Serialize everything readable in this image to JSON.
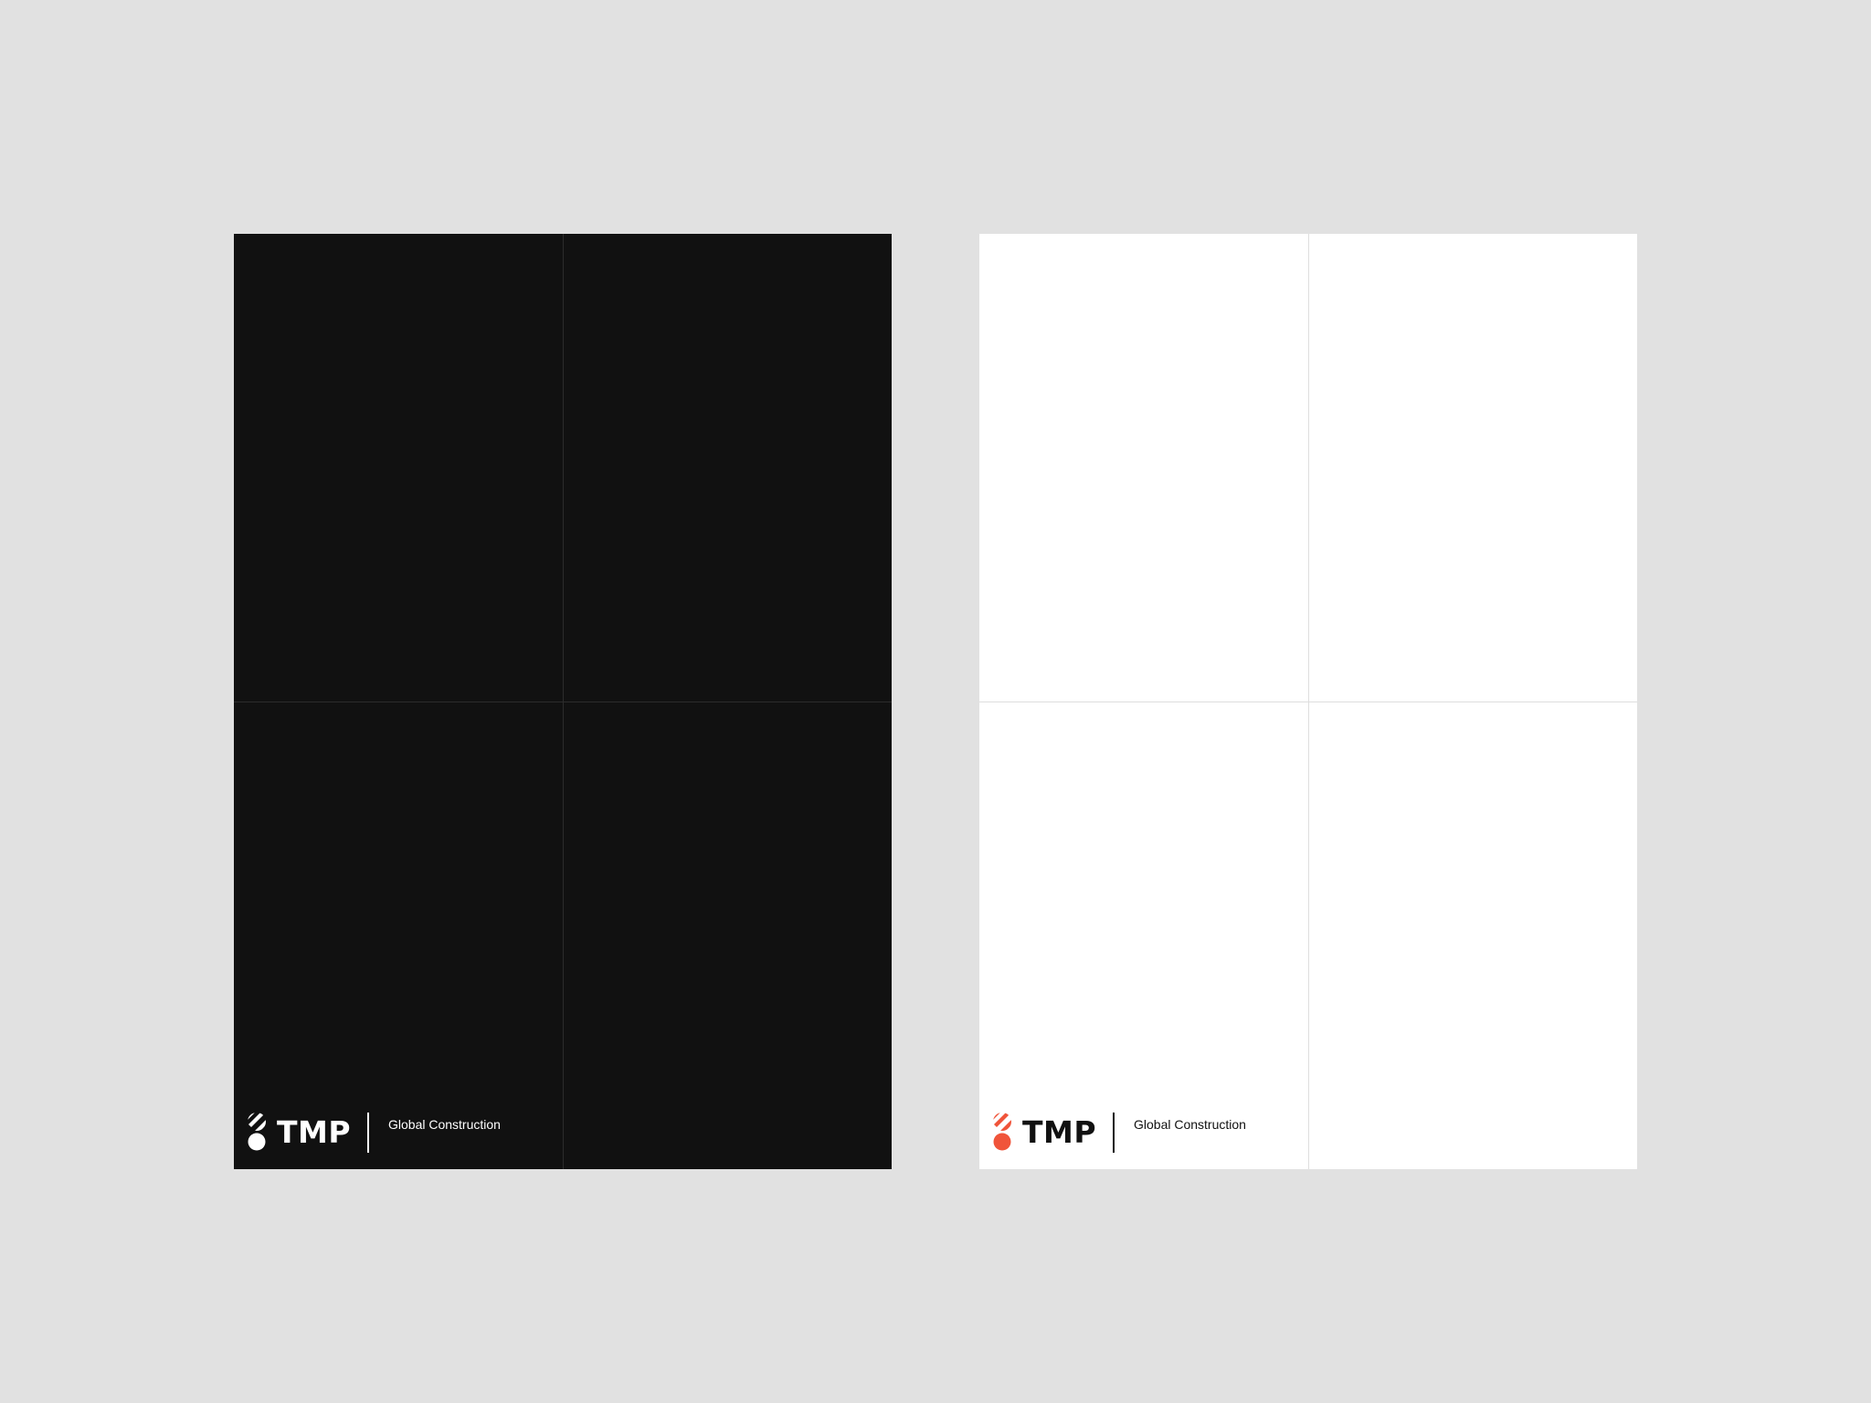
{
  "posters": [
    {
      "variant": "dark",
      "background": "#111111",
      "grid_color": "#2c2c2c",
      "brand": {
        "wordmark": "TMP",
        "tagline": "Global Construction",
        "mark_color": "#ffffff",
        "text_color": "#ffffff"
      }
    },
    {
      "variant": "light",
      "background": "#ffffff",
      "grid_color": "#dedede",
      "brand": {
        "wordmark": "TMP",
        "tagline": "Global Construction",
        "mark_color": "#f0543a",
        "text_color": "#111111"
      }
    }
  ],
  "canvas": {
    "background": "#e1e1e1"
  }
}
